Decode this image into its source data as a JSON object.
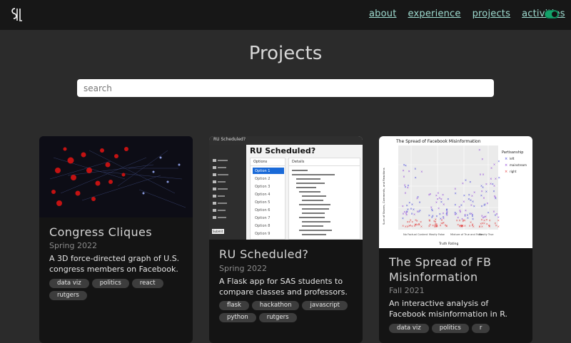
{
  "header": {
    "nav": [
      "about",
      "experience",
      "projects",
      "activities"
    ],
    "theme_toggle_on": true
  },
  "page": {
    "title": "Projects",
    "search_placeholder": "search"
  },
  "projects": [
    {
      "title": "Congress Cliques",
      "date": "Spring 2022",
      "description": "A 3D force-directed graph of U.S. congress members on Facebook.",
      "tags": [
        "data viz",
        "politics",
        "react",
        "rutgers"
      ]
    },
    {
      "title": "RU Scheduled?",
      "date": "Spring 2022",
      "description": "A Flask app for SAS students to compare classes and professors.",
      "tags": [
        "flask",
        "hackathon",
        "javascript",
        "python",
        "rutgers"
      ],
      "screenshot": {
        "app_title": "RU Scheduled?",
        "heading": "RU Scheduled?",
        "options_header": "Options",
        "details_header": "Details",
        "options": [
          "Option 1",
          "Option 2",
          "Option 3",
          "Option 4",
          "Option 5",
          "Option 6",
          "Option 7",
          "Option 8",
          "Option 9"
        ],
        "submit": "Submit"
      }
    },
    {
      "title": "The Spread of FB Misinformation",
      "date": "Fall 2021",
      "description": "An interactive analysis of Facebook misinformation in R.",
      "tags": [
        "data viz",
        "politics",
        "r"
      ],
      "plot": {
        "title": "The Spread of Facebook Misinformation",
        "xlabel": "Truth Rating",
        "ylabel": "Sum of Shares, Comments, and Reactions",
        "categories": [
          "No Factual Content",
          "Mostly False",
          "Mixture of True and False",
          "Mostly True"
        ],
        "legend_title": "Partisanship",
        "legend": [
          "left",
          "mainstream",
          "right"
        ]
      }
    }
  ]
}
